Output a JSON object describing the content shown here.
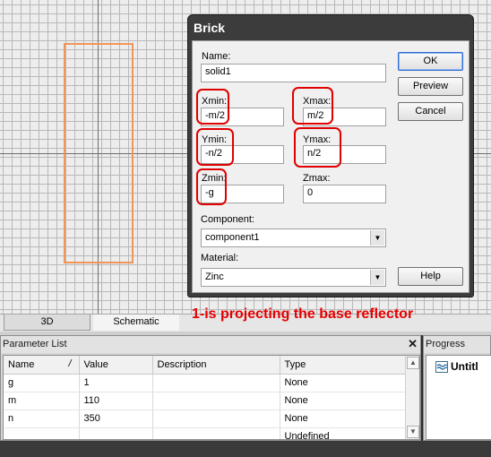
{
  "workspace": {
    "tabs": {
      "tab_3d": "3D",
      "tab_schematic": "Schematic"
    }
  },
  "annotation": "1-is projecting the base reflector",
  "dialog": {
    "title": "Brick",
    "name_label": "Name:",
    "name_value": "solid1",
    "xmin_label": "Xmin:",
    "xmin_value": "-m/2",
    "xmax_label": "Xmax:",
    "xmax_value": "m/2",
    "ymin_label": "Ymin:",
    "ymin_value": "-n/2",
    "ymax_label": "Ymax:",
    "ymax_value": "n/2",
    "zmin_label": "Zmin:",
    "zmin_value": "-g",
    "zmax_label": "Zmax:",
    "zmax_value": "0",
    "component_label": "Component:",
    "component_value": "component1",
    "material_label": "Material:",
    "material_value": "Zinc",
    "ok_label": "OK",
    "preview_label": "Preview",
    "cancel_label": "Cancel",
    "help_label": "Help"
  },
  "parameter_list": {
    "title": "Parameter List",
    "close_glyph": "✕",
    "columns": [
      "Name",
      "Value",
      "Description",
      "Type"
    ],
    "sort_indicator": "/",
    "rows": [
      {
        "name": "g",
        "value": "1",
        "description": "",
        "type": "None"
      },
      {
        "name": "m",
        "value": "110",
        "description": "",
        "type": "None"
      },
      {
        "name": "n",
        "value": "350",
        "description": "",
        "type": "None"
      },
      {
        "name": "",
        "value": "",
        "description": "",
        "type": "Undefined"
      }
    ]
  },
  "progress": {
    "title": "Progress",
    "item": "Untitl"
  },
  "colors": {
    "highlight": "#e00000",
    "brick_outline": "#f0955a",
    "annotation": "#e60000"
  }
}
